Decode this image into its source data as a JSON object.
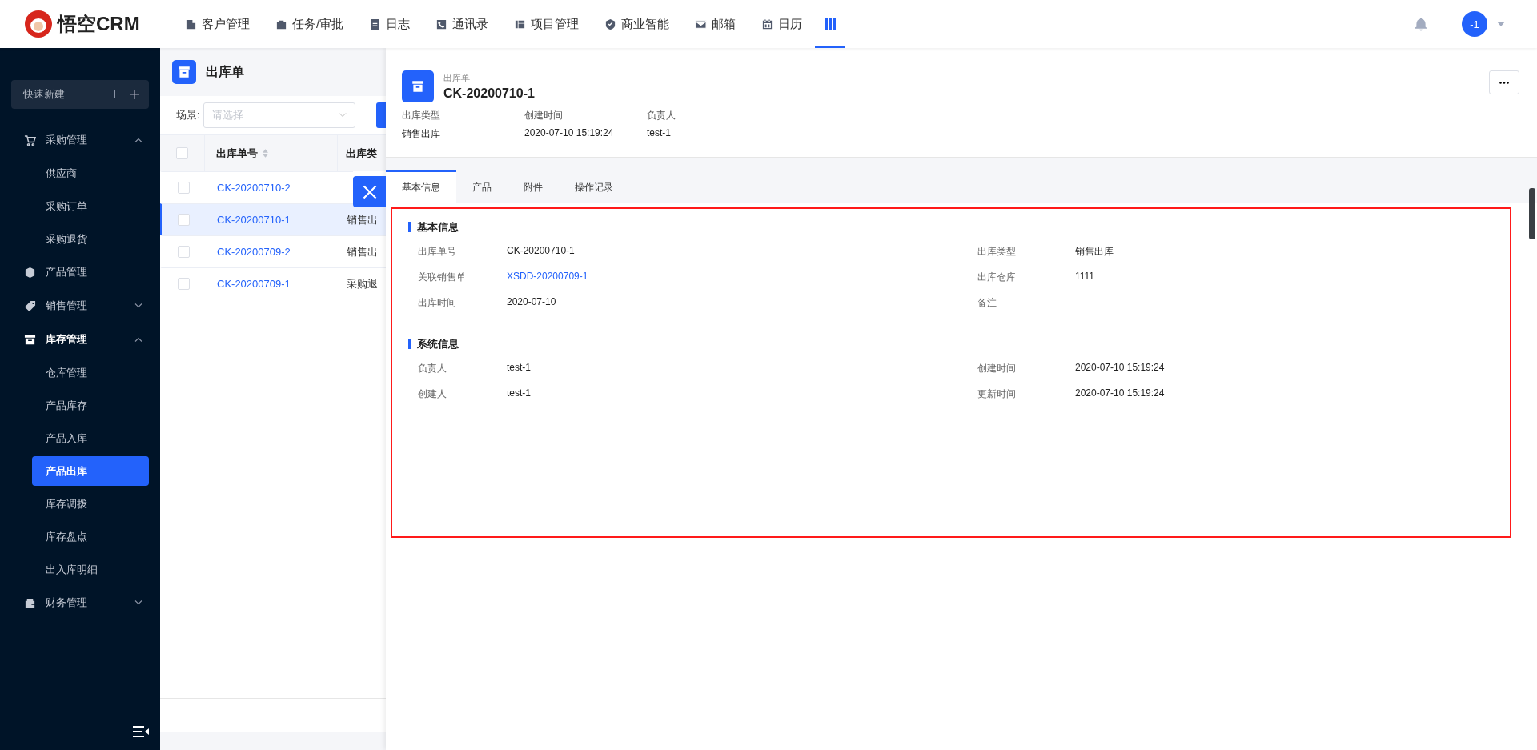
{
  "header": {
    "logo_text": "悟空CRM",
    "nav_items": [
      {
        "label": "客户管理"
      },
      {
        "label": "任务/审批"
      },
      {
        "label": "日志"
      },
      {
        "label": "通讯录"
      },
      {
        "label": "项目管理"
      },
      {
        "label": "商业智能"
      },
      {
        "label": "邮箱"
      },
      {
        "label": "日历"
      }
    ],
    "apps_button": {
      "selected": true
    },
    "avatar": "-1"
  },
  "sidebar": {
    "quick_create": "快速新建",
    "menu": [
      {
        "label": "采购管理",
        "expanded": true,
        "children": [
          {
            "label": "供应商",
            "selected": false
          },
          {
            "label": "采购订单",
            "selected": false
          },
          {
            "label": "采购退货",
            "selected": false
          }
        ]
      },
      {
        "label": "产品管理"
      },
      {
        "label": "销售管理",
        "expanded": false
      },
      {
        "label": "库存管理",
        "expanded": true,
        "children": [
          {
            "label": "仓库管理",
            "selected": false
          },
          {
            "label": "产品库存",
            "selected": false
          },
          {
            "label": "产品入库",
            "selected": false
          },
          {
            "label": "产品出库",
            "selected": true
          },
          {
            "label": "库存调拨",
            "selected": false
          },
          {
            "label": "库存盘点",
            "selected": false
          },
          {
            "label": "出入库明细",
            "selected": false
          }
        ]
      },
      {
        "label": "财务管理",
        "expanded": false
      }
    ]
  },
  "list": {
    "title": "出库单",
    "filter_label": "场景:",
    "filter": {
      "placeholder": "请选择"
    },
    "all_checked": false,
    "columns": [
      "出库单号",
      "出库类"
    ],
    "rows": [
      {
        "number": "CK-20200710-2",
        "selected": false,
        "checked": false
      },
      {
        "number": "CK-20200710-1",
        "type": "销售出",
        "selected": true,
        "checked": false
      },
      {
        "number": "CK-20200709-2",
        "type": "销售出",
        "selected": false,
        "checked": false
      },
      {
        "number": "CK-20200709-1",
        "type": "采购退",
        "selected": false,
        "checked": false
      }
    ]
  },
  "detail": {
    "subtitle": "出库单",
    "title": "CK-20200710-1",
    "summary": [
      {
        "label": "出库类型",
        "value": "销售出库"
      },
      {
        "label": "创建时间",
        "value": "2020-07-10 15:19:24"
      },
      {
        "label": "负责人",
        "value": "test-1"
      }
    ],
    "tabs": [
      {
        "label": "基本信息",
        "selected": true
      },
      {
        "label": "产品",
        "selected": false
      },
      {
        "label": "附件",
        "selected": false
      },
      {
        "label": "操作记录",
        "selected": false
      }
    ],
    "sections": [
      {
        "title": "基本信息",
        "fields": [
          {
            "label": "出库单号",
            "value": "CK-20200710-1",
            "link": false
          },
          {
            "label": "出库类型",
            "value": "销售出库",
            "link": false
          },
          {
            "label": "关联销售单",
            "value": "XSDD-20200709-1",
            "link": true
          },
          {
            "label": "出库仓库",
            "value": "1111",
            "link": false
          },
          {
            "label": "出库时间",
            "value": "2020-07-10",
            "link": false
          },
          {
            "label": "备注"
          }
        ]
      },
      {
        "title": "系统信息",
        "fields": [
          {
            "label": "负责人",
            "value": "test-1",
            "link": false
          },
          {
            "label": "创建时间",
            "value": "2020-07-10 15:19:24",
            "link": false
          },
          {
            "label": "创建人",
            "value": "test-1",
            "link": false
          },
          {
            "label": "更新时间",
            "value": "2020-07-10 15:19:24",
            "link": false
          }
        ]
      }
    ]
  }
}
